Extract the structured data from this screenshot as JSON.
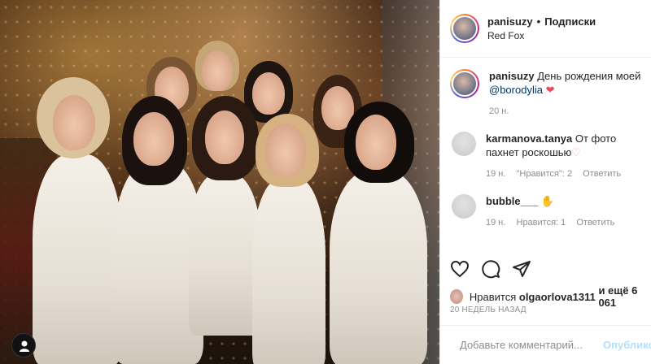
{
  "header": {
    "username": "panisuzy",
    "separator": "•",
    "follow_label": "Подписки",
    "location": "Red Fox"
  },
  "caption": {
    "username": "panisuzy",
    "text": "День рождения моей",
    "mention": "@borodylia",
    "emoji": "❤",
    "time": "20 н."
  },
  "comments": [
    {
      "username": "karmanova.tanya",
      "text": "От фото пахнет роскошью",
      "emoji": "♡",
      "time": "19 н.",
      "likes": "\"Нравится\": 2",
      "reply": "Ответить"
    },
    {
      "username": "bubble___",
      "text": "",
      "emoji": "✋",
      "time": "19 н.",
      "likes": "Нравится: 1",
      "reply": "Ответить"
    }
  ],
  "likes_line": {
    "prefix": "Нравится",
    "user": "olgaorlova1311",
    "suffix": "и ещё 6 061"
  },
  "time_ago": "20 НЕДЕЛЬ НАЗАД",
  "add_comment": {
    "placeholder": "Добавьте комментарий...",
    "publish": "Опубликовать"
  },
  "icons": {
    "like": "heart-icon",
    "comment": "comment-icon",
    "share": "send-icon",
    "emoji": "smiley-icon",
    "tag": "user-tag-icon"
  },
  "colors": {
    "accent": "#0095f6",
    "link": "#00376b",
    "heart": "#ed4956",
    "muted": "#8e8e8e"
  }
}
